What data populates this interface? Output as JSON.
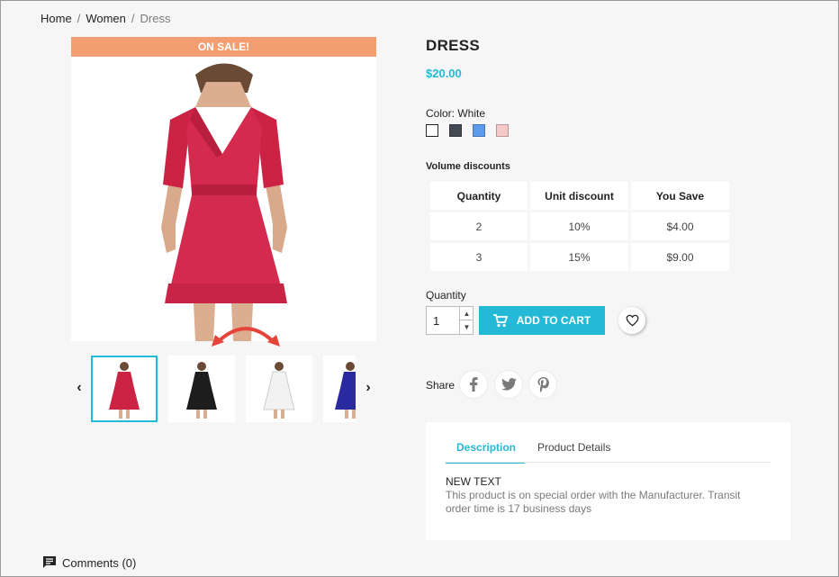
{
  "breadcrumb": {
    "home": "Home",
    "sep": "/",
    "women": "Women",
    "current": "Dress"
  },
  "gallery": {
    "badge": "ON SALE!",
    "prev_glyph": "‹",
    "next_glyph": "›",
    "thumb_colors": [
      "#cc2244",
      "#1d1d1d",
      "#f2f2f2",
      "#2a2aa0"
    ]
  },
  "product": {
    "title": "DRESS",
    "price": "$20.00",
    "color_label": "Color: White",
    "swatches": [
      "#ffffff",
      "#434a54",
      "#5d9cec",
      "#f6c9c9"
    ]
  },
  "volume_discounts": {
    "title": "Volume discounts",
    "headers": [
      "Quantity",
      "Unit discount",
      "You Save"
    ],
    "rows": [
      [
        "2",
        "10%",
        "$4.00"
      ],
      [
        "3",
        "15%",
        "$9.00"
      ]
    ]
  },
  "purchase": {
    "quantity_label": "Quantity",
    "quantity_value": "1",
    "add_to_cart": "ADD TO CART"
  },
  "share": {
    "label": "Share"
  },
  "tabs": {
    "description": "Description",
    "details": "Product Details",
    "desc_title": "NEW TEXT",
    "desc_text": "This product is on special order with the Manufacturer. Transit order time is 17 business days"
  },
  "comments": {
    "label": "Comments (0)"
  },
  "colors": {
    "accent": "#24b9d7",
    "sale": "#f39d72",
    "arrow": "#e6433a"
  }
}
